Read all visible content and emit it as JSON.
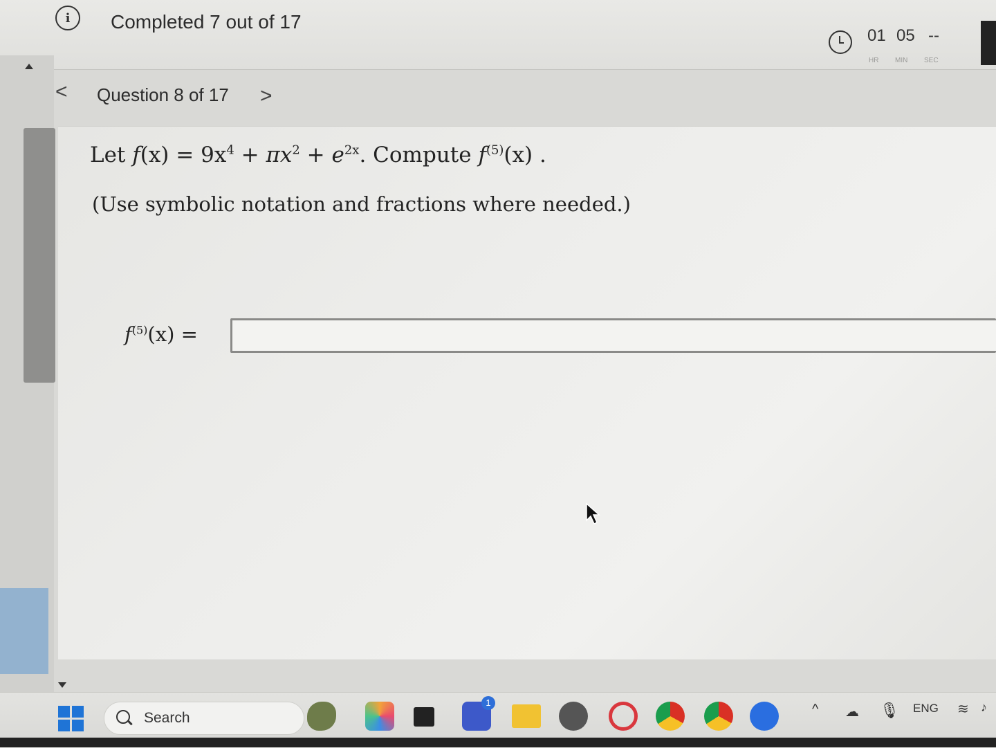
{
  "header": {
    "progress_text": "Completed 7 out of 17",
    "timer": {
      "hours": "01",
      "minutes": "05",
      "seconds": "--",
      "hours_label": "HR",
      "minutes_label": "MIN",
      "seconds_label": "SEC"
    }
  },
  "nav": {
    "prev_glyph": "<",
    "question_label": "Question 8 of 17",
    "next_glyph": ">"
  },
  "question": {
    "let": "Let",
    "f": "f",
    "x_paren": "(x)",
    "eq": "=",
    "term1": "9x",
    "term1_exp": "4",
    "plus": "+",
    "term2": "πx",
    "term2_exp": "2",
    "term3": "e",
    "term3_exp": "2x",
    "compute": ". Compute",
    "deriv_order": "(5)",
    "end": "(x) .",
    "hint": "(Use symbolic notation and fractions where needed.)"
  },
  "answer": {
    "label_f": "f",
    "label_order": "(5)",
    "label_rest": "(x) =",
    "value": ""
  },
  "taskbar": {
    "search_label": "Search",
    "teams_badge": "1",
    "language": "ENG"
  },
  "icons": {
    "info": "info-icon",
    "timer": "clock-icon",
    "search": "search-icon",
    "windows": "windows-start-icon"
  },
  "colors": {
    "accent": "#1f74d6",
    "text": "#222222",
    "background": "#e6e6e3"
  }
}
